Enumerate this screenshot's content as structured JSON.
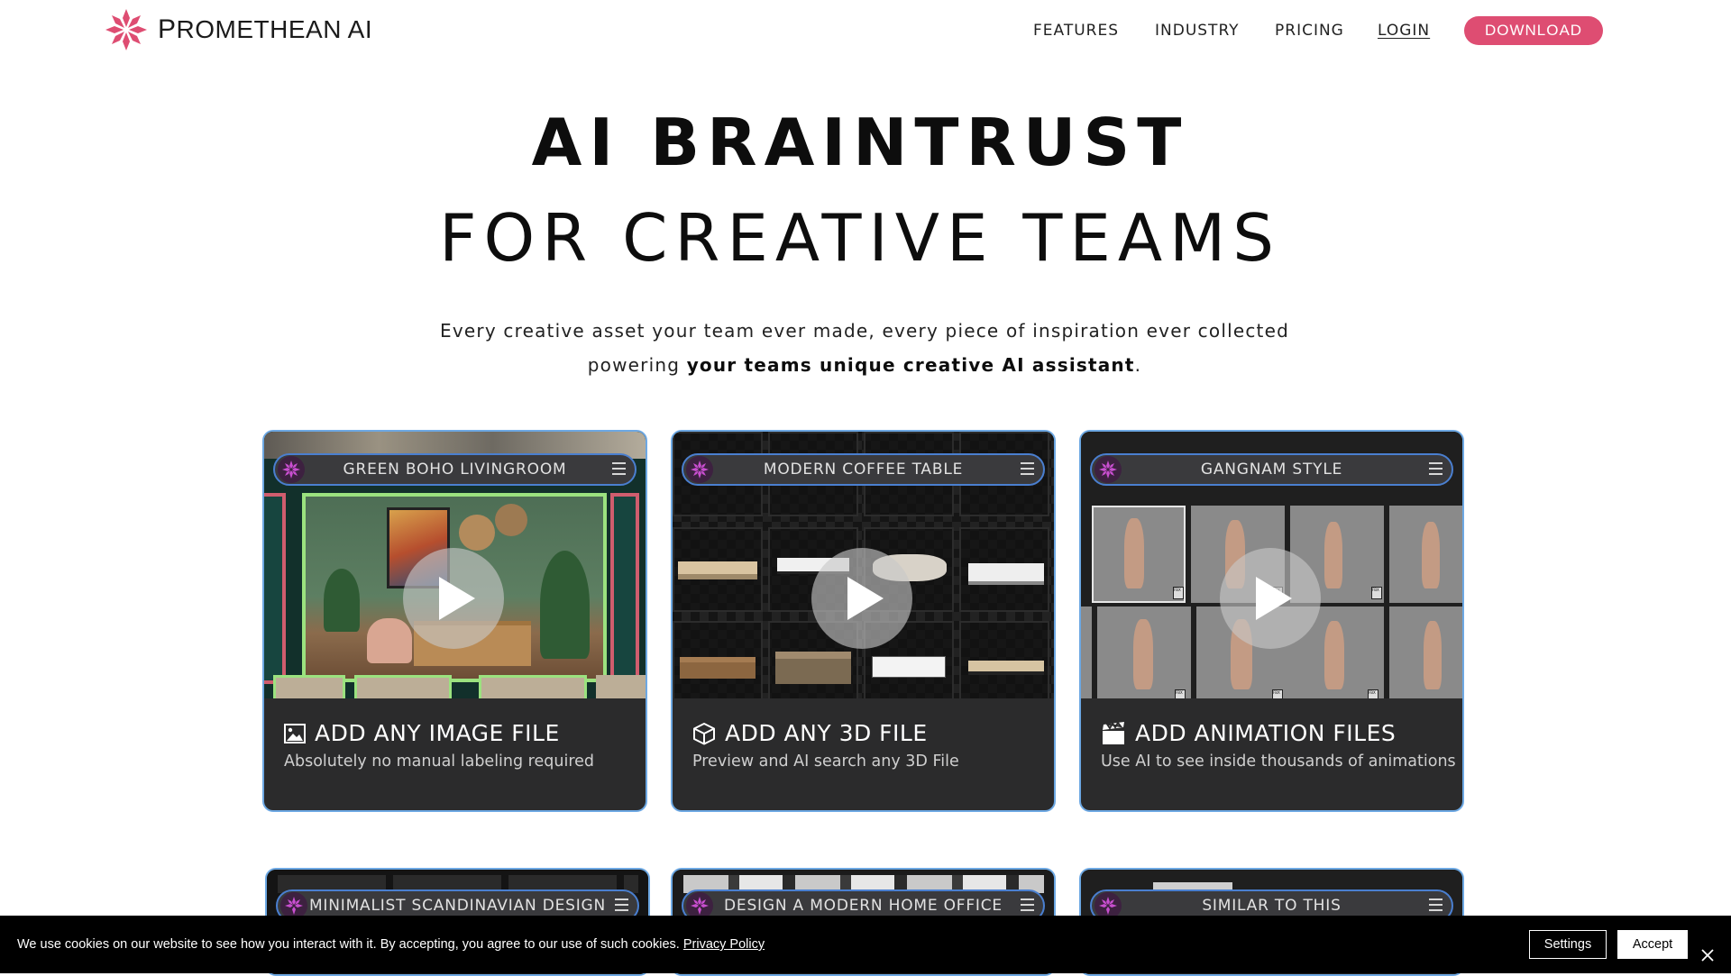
{
  "brand": {
    "name_initial": "P",
    "name_rest": "ROMETHEAN",
    "name_suffix": "AI",
    "accent": "#de4d72",
    "border_blue": "#6da8e3"
  },
  "nav": {
    "features": "FEATURES",
    "industry": "INDUSTRY",
    "pricing": "PRICING",
    "login": "LOGIN",
    "download": "DOWNLOAD"
  },
  "hero": {
    "title_line1": "AI BRAINTRUST",
    "title_line2": "FOR CREATIVE TEAMS",
    "subtitle_line1": "Every creative asset your team ever made, every piece of inspiration ever collected",
    "subtitle_line2_prefix": "powering ",
    "subtitle_line2_bold": "your teams unique creative AI assistant",
    "subtitle_line2_suffix": "."
  },
  "cards": [
    {
      "bar_label": "GREEN BOHO LIVINGROOM",
      "icon": "image-icon",
      "title": "ADD ANY IMAGE FILE",
      "description": "Absolutely no manual labeling required"
    },
    {
      "bar_label": "MODERN COFFEE TABLE",
      "icon": "cube-icon",
      "title": "ADD ANY 3D FILE",
      "description": "Preview and AI search any 3D File"
    },
    {
      "bar_label": "GANGNAM STYLE",
      "icon": "clapperboard-icon",
      "title": "ADD ANIMATION FILES",
      "description": "Use AI to see inside thousands of animations",
      "file_badge": "FBX"
    }
  ],
  "lower_cards": [
    {
      "bar_label": "MINIMALIST SCANDINAVIAN DESIGN"
    },
    {
      "bar_label": "DESIGN A MODERN HOME OFFICE"
    },
    {
      "bar_label": "SIMILAR TO THIS"
    }
  ],
  "cookie": {
    "text": "We use cookies on our website to see how you interact with it. By accepting, you agree to our use of such cookies.",
    "link": "Privacy Policy",
    "settings": "Settings",
    "accept": "Accept"
  }
}
